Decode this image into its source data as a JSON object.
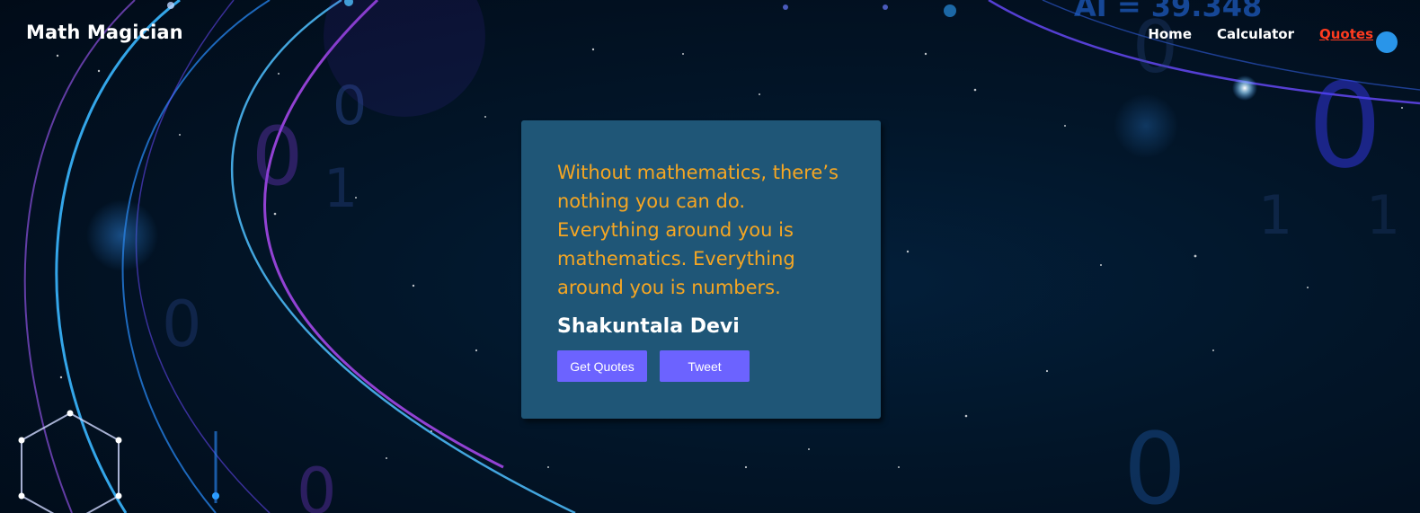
{
  "brand": {
    "title": "Math Magician"
  },
  "nav": {
    "items": [
      {
        "label": "Home"
      },
      {
        "label": "Calculator"
      },
      {
        "label": "Quotes"
      }
    ],
    "active_index": 2
  },
  "quote_card": {
    "text": "Without mathematics, there’s nothing you can do. Everything around you is mathematics. Everything around you is numbers.",
    "author": "Shakuntala Devi",
    "get_quotes_label": "Get Quotes",
    "tweet_label": "Tweet"
  },
  "background": {
    "overlay_text": "AI = 39.348"
  },
  "colors": {
    "quote_text": "#f5a623",
    "card_bg": "#1f5677",
    "button_bg": "#6c63ff",
    "nav_active": "#ff3b1f"
  }
}
